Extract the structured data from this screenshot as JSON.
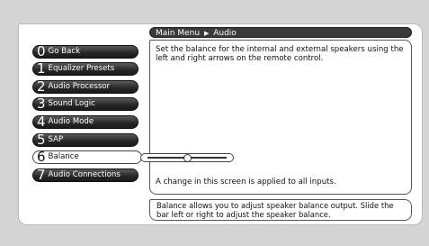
{
  "breadcrumb": {
    "root": "Main Menu",
    "arrow": "▶",
    "current": "Audio"
  },
  "menu": [
    {
      "num": "0",
      "label": "Go Back"
    },
    {
      "num": "1",
      "label": "Equalizer Presets"
    },
    {
      "num": "2",
      "label": "Audio Processor"
    },
    {
      "num": "3",
      "label": "Sound Logic"
    },
    {
      "num": "4",
      "label": "Audio Mode"
    },
    {
      "num": "5",
      "label": "SAP"
    },
    {
      "num": "6",
      "label": "Balance"
    },
    {
      "num": "7",
      "label": "Audio Connections"
    }
  ],
  "selected_index": 6,
  "balance_position": 0.5,
  "description": "Set the balance for the internal and external speakers using the left and right arrows on the remote control.",
  "footer_note": "A change in this screen is applied to all inputs.",
  "help": "Balance allows you to adjust speaker balance output. Slide the bar left or right to adjust the speaker balance."
}
